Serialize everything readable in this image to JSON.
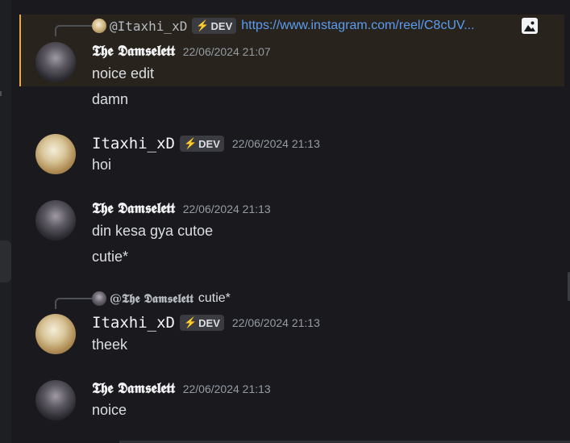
{
  "colors": {
    "background": "#1a1a1e",
    "highlight_bg": "#28241d",
    "highlight_border": "#e8a54b",
    "link": "#5b9cf2",
    "timestamp": "#949ba4",
    "badge_bolt": "#f0b232"
  },
  "messages": [
    {
      "reply": {
        "avatar_icon": "itaxhi-avatar",
        "author": "@Itaxhi_xD",
        "badge": "DEV",
        "badge_icon": "lightning-bolt-icon",
        "link": "https://www.instagram.com/reel/C8cUV...",
        "attachment_icon": "image-icon"
      },
      "author": "𝕿𝖍𝖊 𝕯𝖆𝖒𝖘𝖊𝖑𝖊𝖙𝖙",
      "timestamp": "22/06/2024 21:07",
      "lines": [
        "noice edit",
        "damn"
      ]
    },
    {
      "author": "Itaxhi_xD",
      "badge": "DEV",
      "timestamp": "22/06/2024 21:13",
      "lines": [
        "hoi"
      ]
    },
    {
      "author": "𝕿𝖍𝖊 𝕯𝖆𝖒𝖘𝖊𝖑𝖊𝖙𝖙",
      "timestamp": "22/06/2024 21:13",
      "lines": [
        "din kesa gya cutoe",
        "cutie*"
      ]
    },
    {
      "reply": {
        "avatar_icon": "damselett-avatar",
        "author": "@𝕿𝖍𝖊 𝕯𝖆𝖒𝖘𝖊𝖑𝖊𝖙𝖙",
        "text": "cutie*"
      },
      "author": "Itaxhi_xD",
      "badge": "DEV",
      "timestamp": "22/06/2024 21:13",
      "lines": [
        "theek"
      ]
    },
    {
      "author": "𝕿𝖍𝖊 𝕯𝖆𝖒𝖘𝖊𝖑𝖊𝖙𝖙",
      "timestamp": "22/06/2024 21:13",
      "lines": [
        "noice"
      ]
    }
  ]
}
